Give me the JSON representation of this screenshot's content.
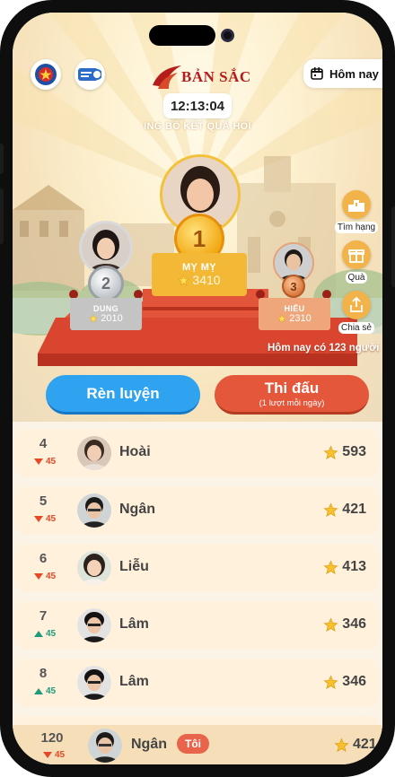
{
  "header": {
    "brand_name": "BẢN SẮC",
    "date_filter_label": "Hôm nay",
    "timer": "12:13:04",
    "subtitle": "ING BỐ KẾT QUẢ HÔI"
  },
  "podium": [
    {
      "place": "1",
      "name": "MỴ MỴ",
      "score": "3410"
    },
    {
      "place": "2",
      "name": "DUNG",
      "score": "2010"
    },
    {
      "place": "3",
      "name": "HIẾU",
      "score": "2310"
    }
  ],
  "side_actions": [
    {
      "label": "Tìm hạng",
      "icon": "podium-icon"
    },
    {
      "label": "Quà",
      "icon": "gift-icon"
    },
    {
      "label": "Chia sẻ",
      "icon": "share-icon"
    }
  ],
  "marquee": "Hôm nay có 123 người",
  "buttons": {
    "train": "Rèn luyện",
    "compete": "Thi đấu",
    "compete_sub": "(1 lượt mỗi ngày)"
  },
  "leaderboard": [
    {
      "rank": "4",
      "change": "45",
      "direction": "down",
      "name": "Hoài",
      "points": "593"
    },
    {
      "rank": "5",
      "change": "45",
      "direction": "down",
      "name": "Ngân",
      "points": "421"
    },
    {
      "rank": "6",
      "change": "45",
      "direction": "down",
      "name": "Liễu",
      "points": "413"
    },
    {
      "rank": "7",
      "change": "45",
      "direction": "up",
      "name": "Lâm",
      "points": "346"
    },
    {
      "rank": "8",
      "change": "45",
      "direction": "up",
      "name": "Lâm",
      "points": "346"
    }
  ],
  "me": {
    "rank": "120",
    "change": "45",
    "direction": "down",
    "name": "Ngân",
    "badge": "Tôi",
    "points": "421"
  },
  "colors": {
    "accent_blue": "#2fa3ef",
    "accent_red": "#e4573a",
    "rank_down": "#e44826",
    "rank_up": "#1f9b7b",
    "star": "#f5c12e"
  }
}
